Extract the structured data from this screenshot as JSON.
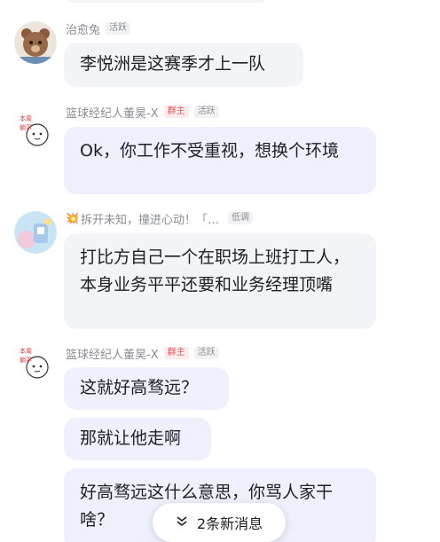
{
  "badges": {
    "owner": "群主",
    "active": "活跃",
    "low_key": "低调"
  },
  "messages": [
    {
      "sender": "治愈兔",
      "text": "李悦洲是这赛季才上一队"
    },
    {
      "sender": "篮球经纪人董昊-X",
      "text": "Ok，你工作不受重视，想换个环境"
    },
    {
      "sender_icon": "💥",
      "sender": "拆开未知，撞进心动！「…",
      "text": "打比方自己一个在职场上班打工人，本身业务平平还要和业务经理顶嘴"
    },
    {
      "sender": "篮球经纪人董昊-X",
      "bubbles": [
        "这就好高骛远？",
        "那就让他走啊",
        "好高骛远这什么意思，你骂人家干啥？"
      ]
    }
  ],
  "new_messages": {
    "icon": "double-chevron-down-icon",
    "label": "2条新消息"
  }
}
